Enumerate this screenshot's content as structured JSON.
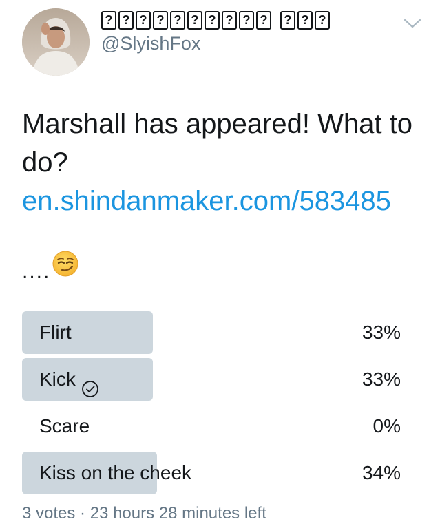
{
  "author": {
    "display_name_glyphs": [
      "?",
      "?",
      "?",
      "?",
      "?",
      "?",
      "?",
      "?",
      "?",
      "?"
    ],
    "display_name_glyphs_2": [
      "?",
      "?",
      "?"
    ],
    "handle": "@SlyishFox",
    "avatar_icon": "profile-photo"
  },
  "tweet": {
    "text": "Marshall has appeared! What to do?",
    "link": "en.shindanmaker.com/583485",
    "ellipsis": "....",
    "emoji": "smirking-face-emoji"
  },
  "poll": {
    "options": [
      {
        "label": "Flirt",
        "percent": 33,
        "percent_text": "33%",
        "selected": false
      },
      {
        "label": "Kick",
        "percent": 33,
        "percent_text": "33%",
        "selected": true
      },
      {
        "label": "Scare",
        "percent": 0,
        "percent_text": "0%",
        "selected": false
      },
      {
        "label": "Kiss on the cheek",
        "percent": 34,
        "percent_text": "34%",
        "selected": false
      }
    ],
    "footer": "3 votes · 23 hours 28 minutes left"
  },
  "colors": {
    "bar": "#ccd6dd",
    "link": "#1b95e0",
    "muted": "#657786",
    "text": "#14171a"
  }
}
